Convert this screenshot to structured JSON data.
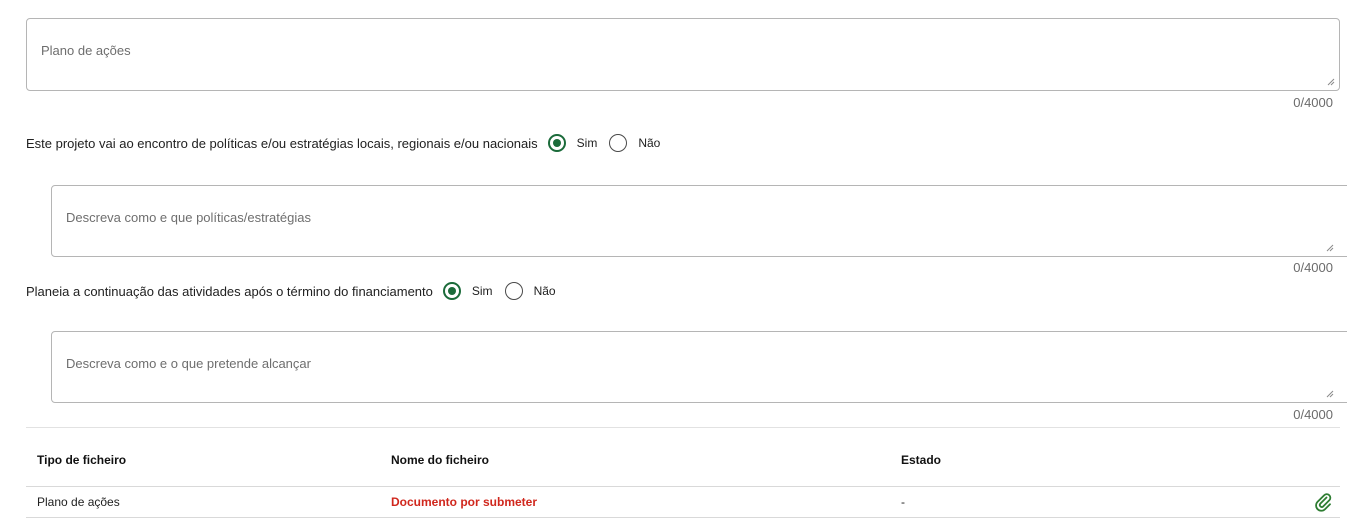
{
  "fields": {
    "action_plan": {
      "placeholder": "Plano de ações",
      "counter": "0/4000"
    },
    "policies_description": {
      "placeholder": "Descreva como e que políticas/estratégias",
      "counter": "0/4000"
    },
    "continuation_description": {
      "placeholder": "Descreva como e o que pretende alcançar",
      "counter": "0/4000"
    }
  },
  "questions": {
    "policies": {
      "text": "Este projeto vai ao encontro de políticas e/ou estratégias locais, regionais e/ou nacionais",
      "options": [
        "Sim",
        "Não"
      ],
      "selected": "Sim"
    },
    "continuation": {
      "text": "Planeia a continuação das atividades após o término do financiamento",
      "options": [
        "Sim",
        "Não"
      ],
      "selected": "Sim"
    }
  },
  "files_table": {
    "headers": [
      "Tipo de ficheiro",
      "Nome do ficheiro",
      "Estado"
    ],
    "rows": [
      {
        "type": "Plano de ações",
        "name": "Documento por submeter",
        "status": "-",
        "action_icon": "paperclip-icon"
      }
    ]
  },
  "colors": {
    "accent_green": "#1b6b3a",
    "missing_red": "#d0271d",
    "border": "#b5b5b5"
  }
}
